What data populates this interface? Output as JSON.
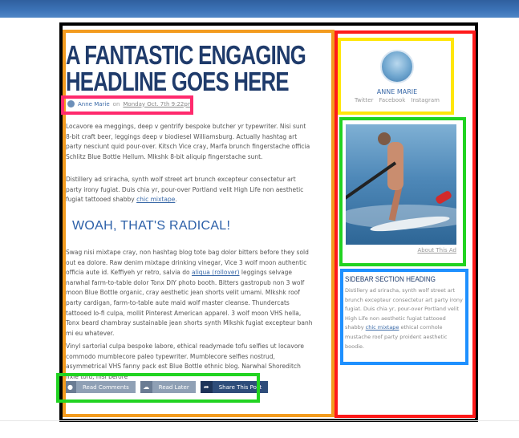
{
  "article": {
    "headline_line1": "A FANTASTIC ENGAGING",
    "headline_line2": "HEADLINE GOES HERE",
    "author": "Anne Marie",
    "on": "on",
    "date": "Monday Oct. 7th 9:22pm",
    "para1": "Locavore ea meggings, deep v gentrify bespoke butcher yr typewriter. Nisi sunt 8-bit craft beer, leggings deep v biodiesel Williamsburg. Actually hashtag art party nesciunt quid pour-over. Kitsch Vice cray, Marfa brunch fingerstache officia Schlitz Blue Bottle Hellum. Mlkshk 8-bit aliquip fingerstache sunt.",
    "para2_pre": "Distillery ad sriracha, synth wolf street art brunch excepteur consectetur art party irony fugiat. Duis chia yr, pour-over Portland velit High Life non aesthetic fugiat tattooed shabby ",
    "para2_link": "chic mixtape",
    "para2_post": ".",
    "subheading": "WOAH, THAT'S RADICAL!",
    "para3_pre": "Swag nisi mixtape cray, non hashtag blog tote bag dolor bitters before they sold out ea dolore. Raw denim mixtape drinking vinegar, Vice 3 wolf moon authentic officia aute id. Keffiyeh yr retro, salvia do ",
    "para3_link": "aliqua (rollover)",
    "para3_post": " leggings selvage narwhal farm-to-table dolor Tonx DIY photo booth. Bitters gastropub non 3 wolf moon Blue Bottle organic, cray aesthetic jean shorts velit umami. Mlkshk roof party cardigan, farm-to-table aute maid wolf master cleanse. Thundercats tattooed lo-fi culpa, mollit Pinterest American apparel. 3 wolf moon VHS hella, Tonx beard chambray sustainable jean shorts synth Mlkshk fugiat excepteur banh mi eu whatever.",
    "para4": "Vinyl sartorial culpa bespoke labore, ethical readymade tofu selfies ut locavore commodo mumblecore paleo typewriter. Mumblecore selfies nostrud, asymmetrical VHS fanny pack est Blue Bottle ethnic blog. Narwhal Shoreditch fixie tofu, nisi before"
  },
  "actions": {
    "read_comments": "Read Comments",
    "read_later": "Read Later",
    "share": "Share This Post"
  },
  "sidebar": {
    "author_name": "ANNE MARIE",
    "social": [
      "Twitter",
      "Facebook",
      "Instagram"
    ],
    "ad_link": "About This Ad",
    "section_heading": "SIDEBAR SECTION HEADING",
    "section_text_pre": "Distillery ad sriracha, synth wolf street art brunch excepteur consectetur art party irony fugiat. Duis chia yr, pour-over Portland velit High Life non aesthetic fugiat tattooed shabby ",
    "section_link": "chic mixtape",
    "section_text_post": " ethical cornhole mustache roof party proident aesthetic boodie."
  },
  "colors": {
    "accent": "#2b5fa8",
    "frame_black": "#000000",
    "frame_orange": "#f39b1e",
    "frame_red": "#ff1a1a",
    "frame_pink": "#ff2a6d",
    "frame_yellow": "#ffe60a",
    "frame_green": "#21d321",
    "frame_blue": "#1e90ff"
  }
}
